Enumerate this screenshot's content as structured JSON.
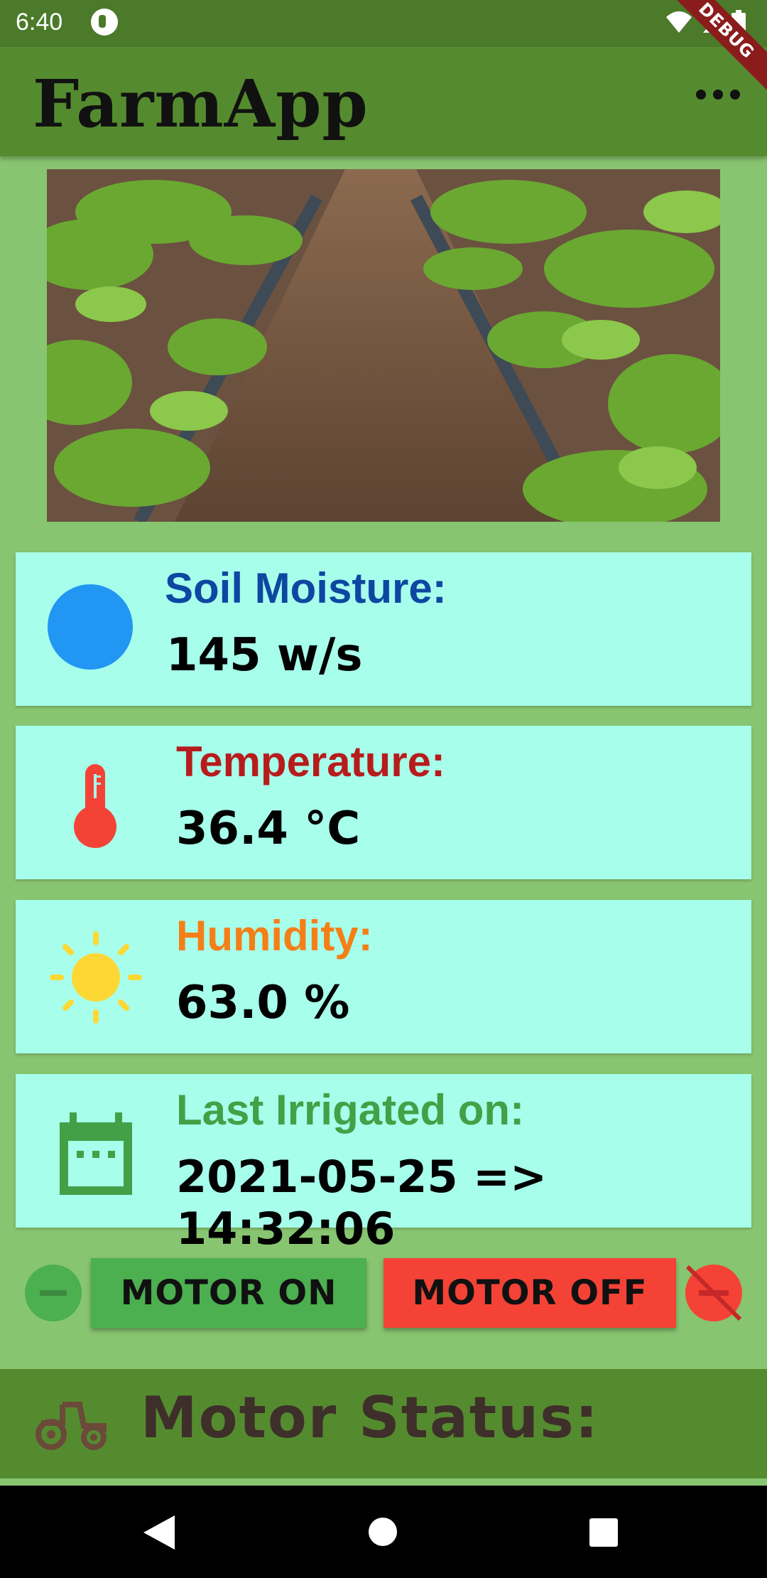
{
  "status_bar": {
    "time": "6:40"
  },
  "app_bar": {
    "title": "FarmApp",
    "debug_banner": "DEBUG"
  },
  "banner_image": {
    "description_icon": "field-photo"
  },
  "cards": {
    "soil": {
      "label": "Soil Moisture:",
      "value": "145 w/s",
      "label_color": "#0d47a1",
      "icon": "circle-icon",
      "icon_color": "#2196f3"
    },
    "temperature": {
      "label": "Temperature:",
      "value": "36.4 °C",
      "label_color": "#b71c1c",
      "icon": "thermometer-icon",
      "icon_color": "#f44336"
    },
    "humidity": {
      "label": "Humidity:",
      "value": "63.0 %",
      "label_color": "#f57f17",
      "icon": "sun-icon",
      "icon_color": "#ffeb3b"
    },
    "irrigation": {
      "label": "Last Irrigated on:",
      "value": "2021-05-25  => 14:32:06",
      "label_color": "#43a047",
      "icon": "calendar-icon",
      "icon_color": "#43a047"
    }
  },
  "controls": {
    "motor_on": "MOTOR ON",
    "motor_off": "MOTOR OFF",
    "on_color": "#4caf50",
    "off_color": "#f44336"
  },
  "motor_status": {
    "label": "Motor Status:"
  },
  "colors": {
    "background": "#88c570",
    "app_bar": "#558b2f",
    "card": "#a7ffeb",
    "status_bar": "#4b7a2a"
  }
}
